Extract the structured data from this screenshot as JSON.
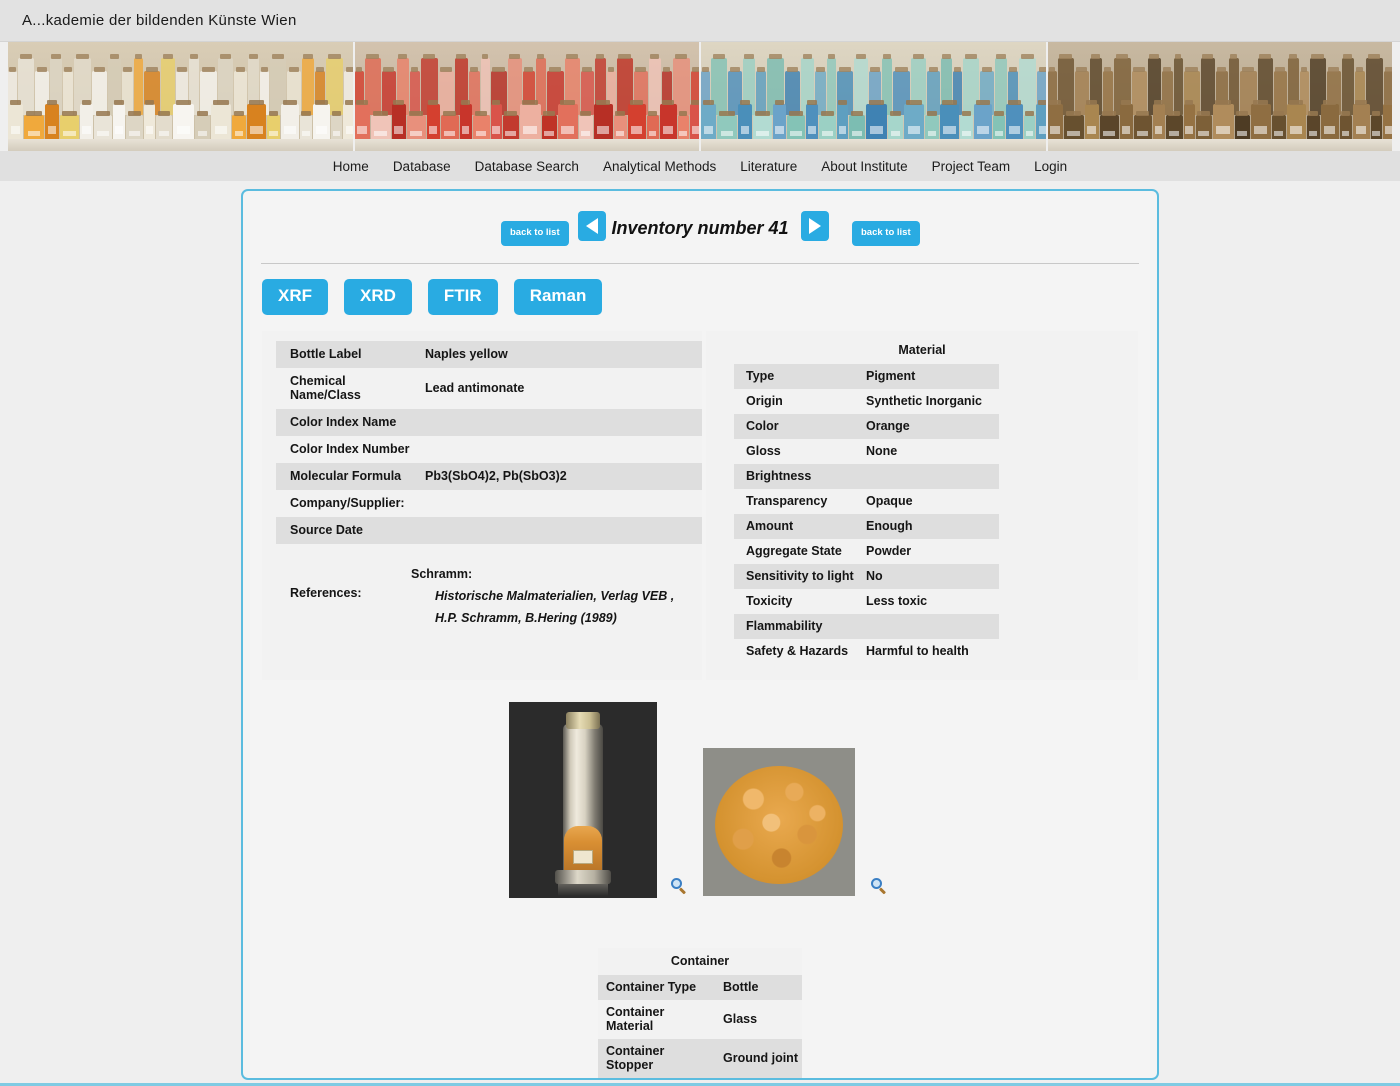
{
  "header": {
    "site_title": "A...kademie der bildenden Künste Wien"
  },
  "banner": {
    "panels": [
      {
        "name": "white-cream-pigment-shelf"
      },
      {
        "name": "red-pink-pigment-shelf"
      },
      {
        "name": "blue-green-pigment-shelf"
      },
      {
        "name": "brown-dark-pigment-shelf"
      }
    ]
  },
  "nav": {
    "items": [
      {
        "label": "Home"
      },
      {
        "label": "Database"
      },
      {
        "label": "Database Search"
      },
      {
        "label": "Analytical Methods"
      },
      {
        "label": "Literature"
      },
      {
        "label": "About Institute"
      },
      {
        "label": "Project Team"
      },
      {
        "label": "Login"
      }
    ]
  },
  "record": {
    "title": "Inventory number 41",
    "back_to_list_left": "back to list",
    "back_to_list_right": "back to list",
    "prev_label": "◀",
    "next_label": "▶"
  },
  "method_tabs": [
    {
      "label": "XRF"
    },
    {
      "label": "XRD"
    },
    {
      "label": "FTIR"
    },
    {
      "label": "Raman"
    }
  ],
  "identity": {
    "rows": [
      {
        "key": "Bottle Label",
        "value": "Naples yellow"
      },
      {
        "key": "Chemical Name/Class",
        "value": "Lead antimonate"
      },
      {
        "key": "Color Index Name",
        "value": ""
      },
      {
        "key": "Color Index Number",
        "value": ""
      },
      {
        "key": "Molecular Formula",
        "value": "Pb3(SbO4)2, Pb(SbO3)2"
      },
      {
        "key": "Company/Supplier:",
        "value": ""
      },
      {
        "key": "Source Date",
        "value": ""
      }
    ],
    "references_label": "References:",
    "references_author": "Schramm:",
    "references_lines": [
      "Historische Malmaterialien, Verlag VEB ,",
      "H.P. Schramm, B.Hering (1989)"
    ]
  },
  "material": {
    "heading": "Material",
    "rows": [
      {
        "key": "Type",
        "value": "Pigment"
      },
      {
        "key": "Origin",
        "value": "Synthetic Inorganic"
      },
      {
        "key": "Color",
        "value": "Orange"
      },
      {
        "key": "Gloss",
        "value": "None"
      },
      {
        "key": "Brightness",
        "value": ""
      },
      {
        "key": "Transparency",
        "value": "Opaque"
      },
      {
        "key": "Amount",
        "value": "Enough"
      },
      {
        "key": "Aggregate State",
        "value": "Powder"
      },
      {
        "key": "Sensitivity to light",
        "value": "No"
      },
      {
        "key": "Toxicity",
        "value": "Less toxic"
      },
      {
        "key": "Flammability",
        "value": ""
      },
      {
        "key": "Safety & Hazards",
        "value": "Harmful to health"
      }
    ]
  },
  "photos": {
    "bottle_alt": "Glass bottle with orange pigment on dark background",
    "powder_alt": "Orange pigment powder sample on grey surface"
  },
  "container": {
    "heading": "Container",
    "rows": [
      {
        "key": "Container Type",
        "value": "Bottle"
      },
      {
        "key": "Container Material",
        "value": "Glass"
      },
      {
        "key": "Container Stopper",
        "value": "Ground joint"
      }
    ]
  },
  "colors": {
    "accent_blue": "#29abe2",
    "border_blue": "#5bbcdf",
    "row_stripe": "#dedede",
    "panel_bg": "#f2f2f2",
    "page_bg": "#efefef",
    "header_bg": "#e2e2e2"
  }
}
